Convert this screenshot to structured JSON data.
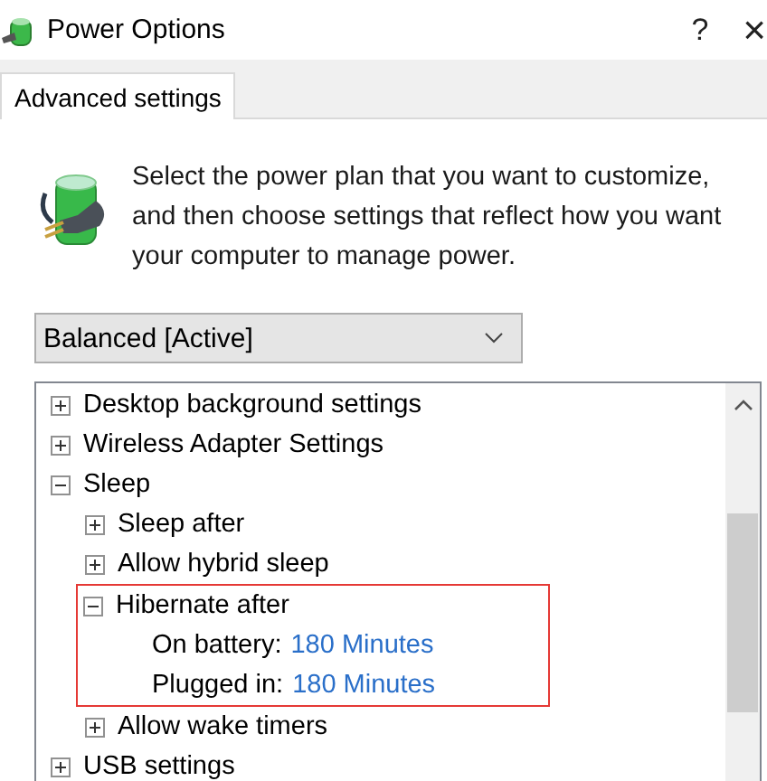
{
  "window": {
    "title": "Power Options",
    "help": "?",
    "close": "×"
  },
  "tabs": [
    {
      "label": "Advanced settings",
      "selected": true
    }
  ],
  "intro": "Select the power plan that you want to customize, and then choose settings that reflect how you want your computer to manage power.",
  "plan_dropdown": {
    "value": "Balanced [Active]"
  },
  "tree": [
    {
      "kind": "group",
      "label": "Desktop background settings",
      "expanded": false,
      "highlighted": false
    },
    {
      "kind": "group",
      "label": "Wireless Adapter Settings",
      "expanded": false,
      "highlighted": false
    },
    {
      "kind": "group",
      "label": "Sleep",
      "expanded": true,
      "highlighted": false,
      "children": [
        {
          "kind": "group",
          "label": "Sleep after",
          "expanded": false,
          "highlighted": false
        },
        {
          "kind": "group",
          "label": "Allow hybrid sleep",
          "expanded": false,
          "highlighted": false
        },
        {
          "kind": "group",
          "label": "Hibernate after",
          "expanded": true,
          "highlighted": true,
          "children": [
            {
              "kind": "setting",
              "label": "On battery:",
              "value": "180 Minutes"
            },
            {
              "kind": "setting",
              "label": "Plugged in:",
              "value": "180 Minutes"
            }
          ]
        },
        {
          "kind": "group",
          "label": "Allow wake timers",
          "expanded": false,
          "highlighted": false
        }
      ]
    },
    {
      "kind": "group",
      "label": "USB settings",
      "expanded": false,
      "highlighted": false
    }
  ]
}
